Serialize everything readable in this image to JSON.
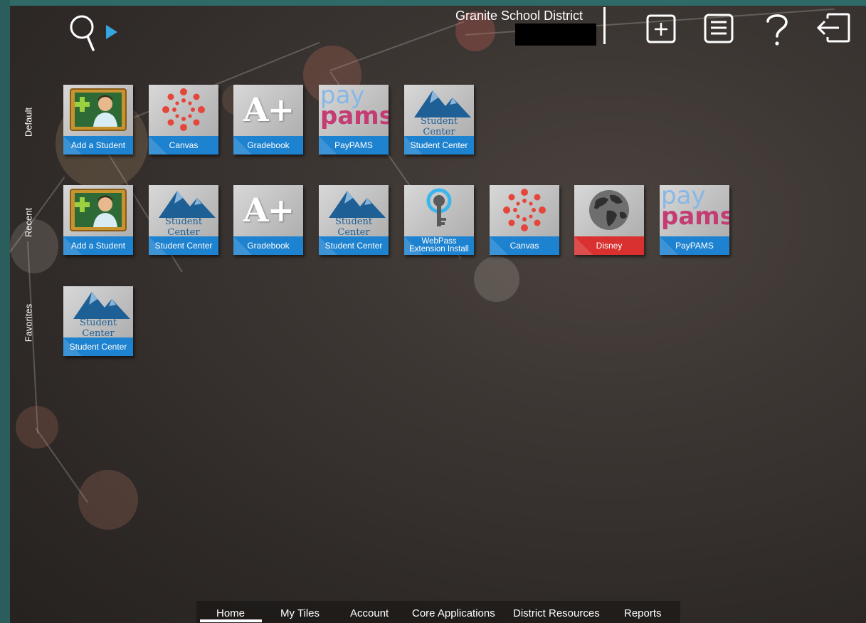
{
  "header": {
    "org_name": "Granite School District",
    "search_icon": "search-icon",
    "expand_icon": "play-arrow-icon",
    "actions": [
      {
        "name": "add-tile-icon",
        "label": "Add"
      },
      {
        "name": "list-icon",
        "label": "List"
      },
      {
        "name": "help-icon",
        "label": "?"
      },
      {
        "name": "logout-icon",
        "label": "Log out"
      }
    ]
  },
  "sections": {
    "default": "Default",
    "recent": "Recent",
    "favorites": "Favorites"
  },
  "tiles": {
    "default": [
      {
        "label": "Add a Student",
        "art": "add-student"
      },
      {
        "label": "Canvas",
        "art": "canvas"
      },
      {
        "label": "Gradebook",
        "art": "gradebook"
      },
      {
        "label": "PayPAMS",
        "art": "paypams"
      },
      {
        "label": "Student Center",
        "art": "student-center"
      }
    ],
    "recent": [
      {
        "label": "Add a Student",
        "art": "add-student"
      },
      {
        "label": "Student Center",
        "art": "student-center"
      },
      {
        "label": "Gradebook",
        "art": "gradebook"
      },
      {
        "label": "Student Center",
        "art": "student-center"
      },
      {
        "label": "WebPass Extension Install",
        "art": "webpass",
        "line1": "WebPass",
        "line2": "Extension Install"
      },
      {
        "label": "Canvas",
        "art": "canvas"
      },
      {
        "label": "Disney",
        "art": "disney"
      },
      {
        "label": "PayPAMS",
        "art": "paypams"
      }
    ],
    "favorites": [
      {
        "label": "Student Center",
        "art": "student-center"
      }
    ]
  },
  "art_text": {
    "student_center": "Student Center",
    "gradebook": "A+",
    "paypams_top": "pay",
    "paypams_bottom": "pams"
  },
  "nav": [
    "Home",
    "My Tiles",
    "Account",
    "Core Applications",
    "District Resources",
    "Reports"
  ],
  "active_nav": "Home",
  "colors": {
    "tile_label": "#1d82cf",
    "tile_label_disney": "#d9312f",
    "accent": "#35a7e0",
    "canvas_red": "#e4463b"
  }
}
